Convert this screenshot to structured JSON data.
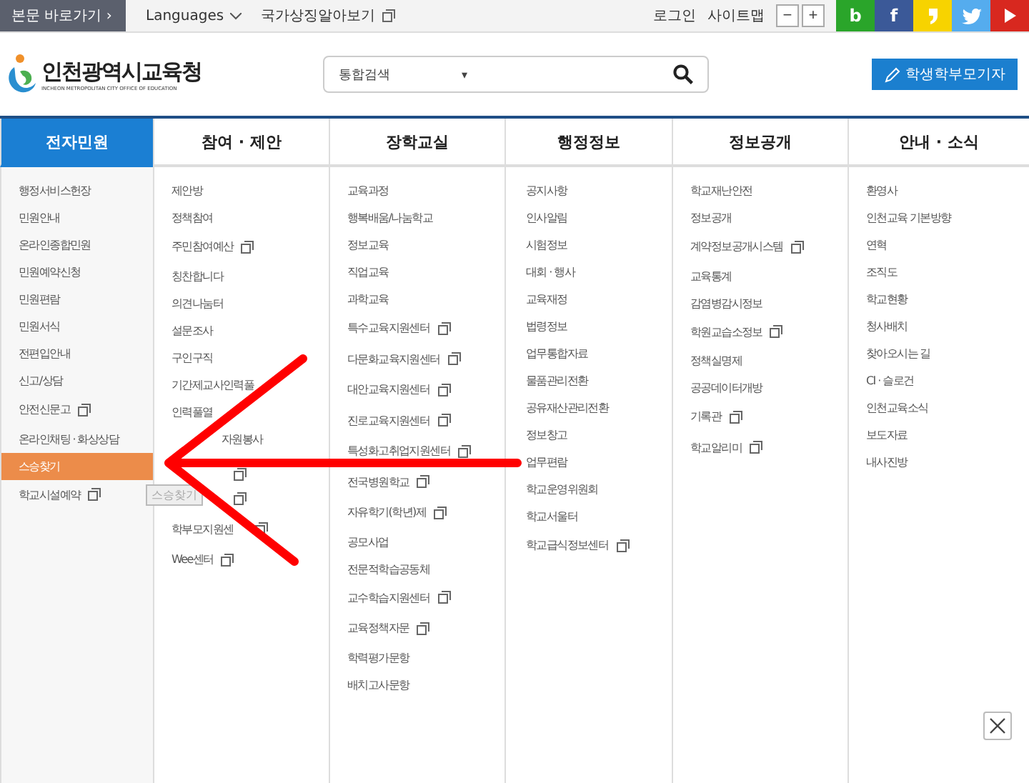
{
  "utility_bar": {
    "skip_link": "본문 바로가기",
    "skip_arrow": "›",
    "languages": "Languages",
    "symbols_link": "국가상징알아보기",
    "login": "로그인",
    "sitemap": "사이트맵",
    "zoom_out": "−",
    "zoom_in": "+"
  },
  "social": [
    {
      "kind": "blog",
      "label": "b",
      "color": "#2aa52a"
    },
    {
      "kind": "facebook",
      "label": "f",
      "color": "#3b5998"
    },
    {
      "kind": "story",
      "color": "#f7d300"
    },
    {
      "kind": "twitter",
      "color": "#55acee"
    },
    {
      "kind": "youtube",
      "color": "#d8281f"
    }
  ],
  "header": {
    "logo_title": "인천광역시교육청",
    "logo_subtitle": "INCHEON METROPOLITAN CITY OFFICE OF EDUCATION",
    "search_scope": "통합검색",
    "search_caret": "▾",
    "reporter_button": "학생학부모기자"
  },
  "nav": [
    {
      "label": "전자민원",
      "selected": true,
      "items": [
        {
          "label": "행정서비스헌장",
          "external": false,
          "selected": false
        },
        {
          "label": "민원안내",
          "external": false,
          "selected": false
        },
        {
          "label": "온라인종합민원",
          "external": false,
          "selected": false
        },
        {
          "label": "민원예약신청",
          "external": false,
          "selected": false
        },
        {
          "label": "민원편람",
          "external": false,
          "selected": false
        },
        {
          "label": "민원서식",
          "external": false,
          "selected": false
        },
        {
          "label": "전편입안내",
          "external": false,
          "selected": false
        },
        {
          "label": "신고/상담",
          "external": false,
          "selected": false
        },
        {
          "label": "안전신문고",
          "external": true,
          "selected": false
        },
        {
          "label": "온라인채팅 · 화상상담",
          "external": false,
          "selected": false
        },
        {
          "label": "스승찾기",
          "external": false,
          "selected": true
        },
        {
          "label": "학교시설예약",
          "external": true,
          "selected": false
        }
      ]
    },
    {
      "label": "참여 · 제안",
      "selected": false,
      "items": [
        {
          "label": "제안방",
          "external": false
        },
        {
          "label": "정책참여",
          "external": false
        },
        {
          "label": "주민참여예산",
          "external": true
        },
        {
          "label": "칭찬합니다",
          "external": false
        },
        {
          "label": "의견나눔터",
          "external": false
        },
        {
          "label": "설문조사",
          "external": false
        },
        {
          "label": "구인구직",
          "external": false
        },
        {
          "label": "기간제교사인력풀",
          "external": false
        },
        {
          "label": "인력풀열",
          "external": false
        },
        {
          "parts": [
            "자원봉사"
          ],
          "external": false
        },
        {
          "external": true
        },
        {
          "external": true
        },
        {
          "label": "학부모지원센",
          "external": true
        },
        {
          "label": "Wee센터",
          "external": true
        }
      ]
    },
    {
      "label": "장학교실",
      "selected": false,
      "items": [
        {
          "label": "교육과정",
          "external": false
        },
        {
          "label": "행복배움/나눔학교",
          "external": false
        },
        {
          "label": "정보교육",
          "external": false
        },
        {
          "label": "직업교육",
          "external": false
        },
        {
          "label": "과학교육",
          "external": false
        },
        {
          "label": "특수교육지원센터",
          "external": true
        },
        {
          "label": "다문화교육지원센터",
          "external": true
        },
        {
          "label": "대안교육지원센터",
          "external": true
        },
        {
          "label": "진로교육지원센터",
          "external": true
        },
        {
          "label": "특성화고취업지원센터",
          "external": true
        },
        {
          "label": "전국병원학교",
          "external": true
        },
        {
          "label": "자유학기(학년)제",
          "external": true
        },
        {
          "label": "공모사업",
          "external": false
        },
        {
          "label": "전문적학습공동체",
          "external": false
        },
        {
          "label": "교수학습지원센터",
          "external": true
        },
        {
          "label": "교육정책자문",
          "external": true
        },
        {
          "label": "학력평가문항",
          "external": false
        },
        {
          "label": "배치고사문항",
          "external": false
        }
      ]
    },
    {
      "label": "행정정보",
      "selected": false,
      "items": [
        {
          "label": "공지사항",
          "external": false
        },
        {
          "label": "인사알림",
          "external": false
        },
        {
          "label": "시험정보",
          "external": false
        },
        {
          "label": "대회 · 행사",
          "external": false
        },
        {
          "label": "교육재정",
          "external": false
        },
        {
          "label": "법령정보",
          "external": false
        },
        {
          "label": "업무통합자료",
          "external": false
        },
        {
          "label": "물품관리전환",
          "external": false
        },
        {
          "label": "공유재산관리전환",
          "external": false
        },
        {
          "label": "정보창고",
          "external": false
        },
        {
          "label": "업무편람",
          "external": false
        },
        {
          "label": "학교운영위원회",
          "external": false
        },
        {
          "label": "학교서울터",
          "external": false
        },
        {
          "label": "학교급식정보센터",
          "external": true
        }
      ]
    },
    {
      "label": "정보공개",
      "selected": false,
      "items": [
        {
          "label": "학교재난안전",
          "external": false
        },
        {
          "label": "정보공개",
          "external": false
        },
        {
          "label": "계약정보공개시스템",
          "external": true
        },
        {
          "label": "교육통계",
          "external": false
        },
        {
          "label": "감염병감시정보",
          "external": false
        },
        {
          "label": "학원교습소정보",
          "external": true
        },
        {
          "label": "정책실명제",
          "external": false
        },
        {
          "label": "공공데이터개방",
          "external": false
        },
        {
          "label": "기록관",
          "external": true
        },
        {
          "label": "학교알리미",
          "external": true
        }
      ]
    },
    {
      "label": "안내 · 소식",
      "selected": false,
      "items": [
        {
          "label": "환영사",
          "external": false
        },
        {
          "label": "인천교육 기본방향",
          "external": false
        },
        {
          "label": "연혁",
          "external": false
        },
        {
          "label": "조직도",
          "external": false
        },
        {
          "label": "학교현황",
          "external": false
        },
        {
          "label": "청사배치",
          "external": false
        },
        {
          "label": "찾아오시는 길",
          "external": false
        },
        {
          "label": "CI · 슬로건",
          "external": false
        },
        {
          "label": "인천교육소식",
          "external": false
        },
        {
          "label": "보도자료",
          "external": false
        },
        {
          "label": "내사진방",
          "external": false
        }
      ]
    }
  ],
  "tooltip": "스승찾기"
}
